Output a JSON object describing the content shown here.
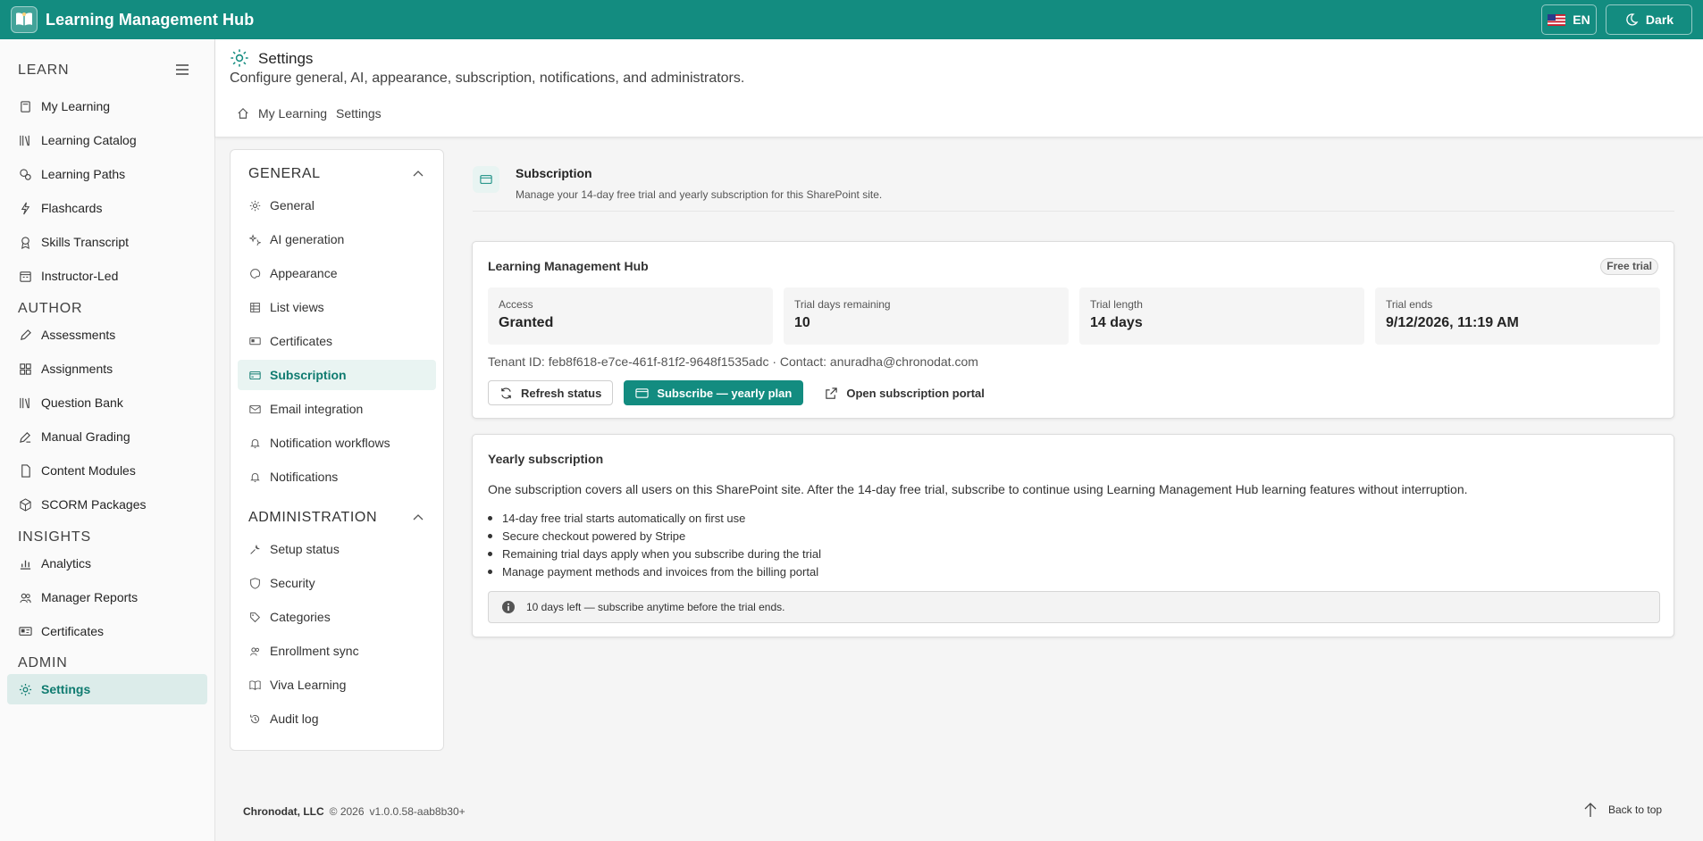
{
  "app": {
    "title": "Learning Management Hub",
    "lang_label": "EN",
    "theme_label": "Dark"
  },
  "sidebar": {
    "sections": [
      {
        "label": "LEARN"
      },
      {
        "label": "AUTHOR"
      },
      {
        "label": "INSIGHTS"
      },
      {
        "label": "ADMIN"
      }
    ],
    "items": [
      {
        "label": "My Learning",
        "icon": "book-icon"
      },
      {
        "label": "Learning Catalog",
        "icon": "library-icon"
      },
      {
        "label": "Learning Paths",
        "icon": "path-icon"
      },
      {
        "label": "Flashcards",
        "icon": "flash-icon"
      },
      {
        "label": "Skills Transcript",
        "icon": "ribbon-icon"
      },
      {
        "label": "Instructor-Led",
        "icon": "calendar-icon"
      },
      {
        "label": "Assessments",
        "icon": "pen-icon"
      },
      {
        "label": "Assignments",
        "icon": "grid-icon"
      },
      {
        "label": "Question Bank",
        "icon": "library-icon"
      },
      {
        "label": "Manual Grading",
        "icon": "grading-icon"
      },
      {
        "label": "Content Modules",
        "icon": "document-icon"
      },
      {
        "label": "SCORM Packages",
        "icon": "package-icon"
      },
      {
        "label": "Analytics",
        "icon": "chart-icon"
      },
      {
        "label": "Manager Reports",
        "icon": "people-icon"
      },
      {
        "label": "Certificates",
        "icon": "certificate-icon"
      },
      {
        "label": "Settings",
        "icon": "gear-icon"
      }
    ]
  },
  "header": {
    "title": "Settings",
    "subtitle": "Configure general, AI, appearance, subscription, notifications, and administrators.",
    "breadcrumb": [
      "My Learning",
      "Settings"
    ]
  },
  "settings_menu": {
    "general_head": "GENERAL",
    "admin_head": "ADMINISTRATION",
    "general_items": [
      {
        "label": "General"
      },
      {
        "label": "AI generation"
      },
      {
        "label": "Appearance"
      },
      {
        "label": "List views"
      },
      {
        "label": "Certificates"
      },
      {
        "label": "Subscription"
      },
      {
        "label": "Email integration"
      },
      {
        "label": "Notification workflows"
      },
      {
        "label": "Notifications"
      }
    ],
    "admin_items": [
      {
        "label": "Setup status"
      },
      {
        "label": "Security"
      },
      {
        "label": "Categories"
      },
      {
        "label": "Enrollment sync"
      },
      {
        "label": "Viva Learning"
      },
      {
        "label": "Audit log"
      }
    ]
  },
  "content": {
    "title": "Subscription",
    "subtitle": "Manage your 14-day free trial and yearly subscription for this SharePoint site.",
    "status_card": {
      "title": "Learning Management Hub",
      "badge": "Free trial",
      "stats": [
        {
          "label": "Access",
          "value": "Granted"
        },
        {
          "label": "Trial days remaining",
          "value": "10"
        },
        {
          "label": "Trial length",
          "value": "14 days"
        },
        {
          "label": "Trial ends",
          "value": "9/12/2026, 11:19 AM"
        }
      ],
      "tenant_line": "Tenant ID: feb8f618-e7ce-461f-81f2-9648f1535adc · Contact: anuradha@chronodat.com",
      "refresh_label": "Refresh status",
      "subscribe_label": "Subscribe — yearly plan",
      "portal_label": "Open subscription portal"
    },
    "yearly_card": {
      "title": "Yearly subscription",
      "description": "One subscription covers all users on this SharePoint site. After the 14-day free trial, subscribe to continue using Learning Management Hub learning features without interruption.",
      "bullets": [
        "14-day free trial starts automatically on first use",
        "Secure checkout powered by Stripe",
        "Remaining trial days apply when you subscribe during the trial",
        "Manage payment methods and invoices from the billing portal"
      ],
      "note": "10 days left — subscribe anytime before the trial ends."
    }
  },
  "footer": {
    "company": "Chronodat, LLC",
    "copyright": "© 2026",
    "version": "v1.0.0.58-aab8b30+",
    "back_to_top": "Back to top"
  },
  "colors": {
    "brand": "#138c80",
    "active_bg": "#dcecea",
    "active_text": "#0f7b70"
  }
}
